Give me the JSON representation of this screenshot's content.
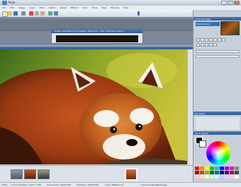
{
  "window": {
    "title": "Pixia",
    "controls": {
      "minimize": "_",
      "maximize": "□",
      "close": "x"
    }
  },
  "menu": {
    "items": [
      "File",
      "Edit",
      "Image",
      "Layer",
      "Filter",
      "Select",
      "Adjust",
      "Effects",
      "Color",
      "Tools",
      "View",
      "Window",
      "Help"
    ]
  },
  "float_window": {
    "title": "Dream something and display: Brand you, then make the dream..."
  },
  "right_panels": {
    "layers": {
      "title": "Layer Manager",
      "selected": "Background"
    },
    "navigator": {
      "title": "Navigator"
    },
    "colors": {
      "title": "Color Palette"
    }
  },
  "status": {
    "zoom": "100%",
    "cursor": "Cursor Position: 1024 x 768",
    "size": "Actual Size: 1024x768",
    "selection": "Selection: 2024x768",
    "color": "Color: RGB(0,0,0)",
    "layer": "Layer: Background",
    "file": "C:\\Pictures\\RedPanda.jpg"
  },
  "colors": {
    "accent": "#2e5a96",
    "panel": "#c7d0da"
  }
}
